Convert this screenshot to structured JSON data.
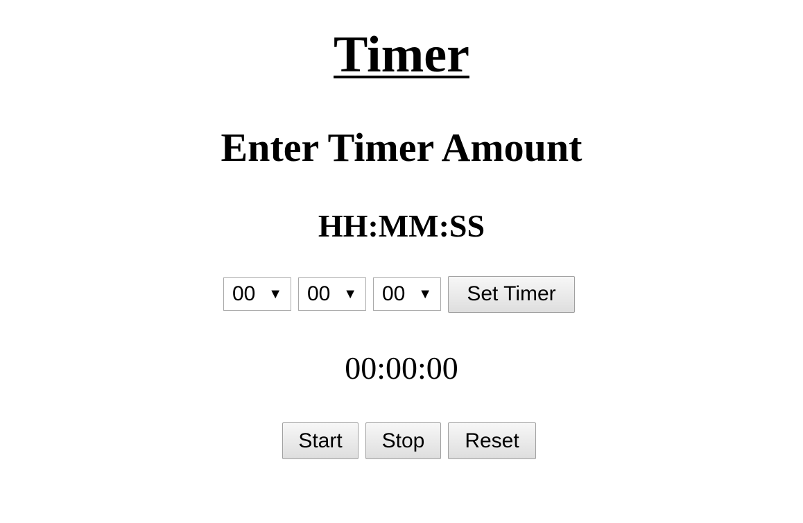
{
  "page": {
    "title": "Timer",
    "subtitle": "Enter Timer Amount",
    "format_label": "HH:MM:SS"
  },
  "controls": {
    "hours": {
      "value": "00",
      "arrow": "▼"
    },
    "minutes": {
      "value": "00",
      "arrow": "▼"
    },
    "seconds": {
      "value": "00",
      "arrow": "▼"
    },
    "set_label": "Set Timer"
  },
  "display": {
    "time": "00:00:00"
  },
  "actions": {
    "start_label": "Start",
    "stop_label": "Stop",
    "reset_label": "Reset"
  }
}
